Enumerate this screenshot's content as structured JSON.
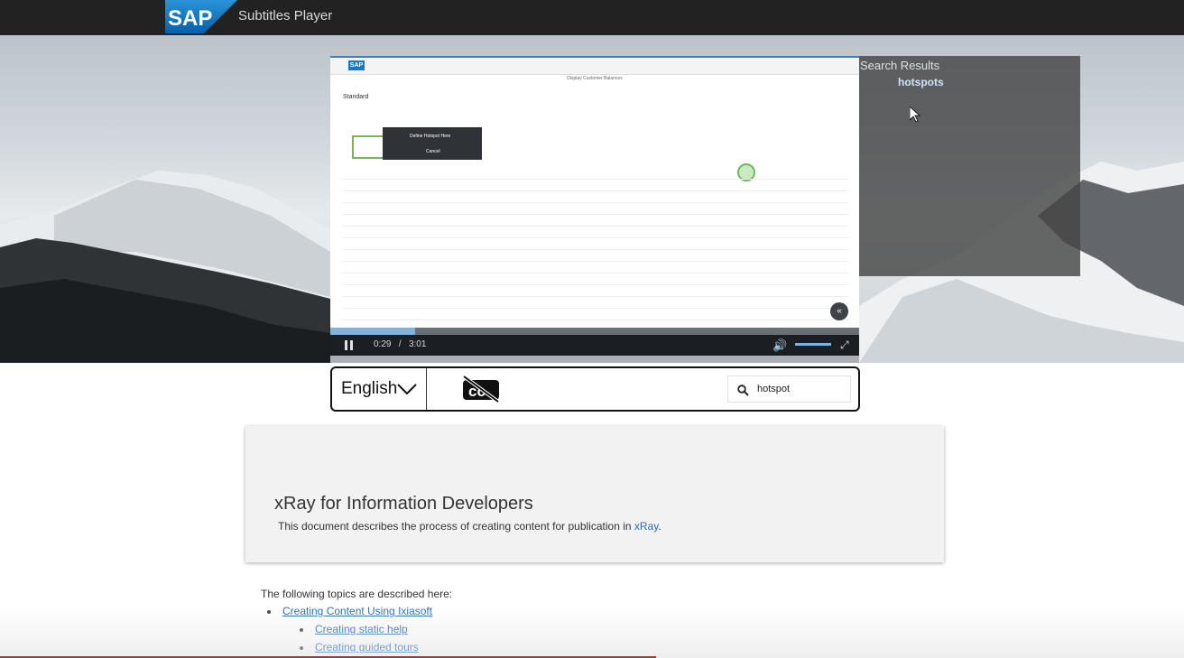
{
  "header": {
    "logo_text": "SAP",
    "app_title": "Subtitles Player"
  },
  "video": {
    "embedded_logo_text": "SAP",
    "embedded_page_title": "Display Customer Balances",
    "embedded_variant_label": "Standard",
    "embedded_popup_line1": "Define Hotspot Here",
    "embedded_popup_line2": "Cancel",
    "current_time": "0:29",
    "duration": "3:01",
    "progress_fraction": 0.16,
    "volume_fraction": 0.8
  },
  "search_results": {
    "title": "Search Results",
    "items": [
      "hotspots"
    ]
  },
  "controls": {
    "language": "English",
    "search_value": "hotspot",
    "cc_icon": "closed-captions-off-icon",
    "search_icon": "search-icon"
  },
  "document": {
    "title": "xRay for Information Developers",
    "description_prefix": "This document describes the process of creating content for publication in ",
    "description_link": "xRay",
    "description_suffix": "."
  },
  "topics": {
    "intro": "The following topics are described here:",
    "items": [
      {
        "label": "Creating Content Using Ixiasoft",
        "children": [
          "Creating static help",
          "Creating guided tours"
        ]
      }
    ]
  },
  "colors": {
    "header_bg": "#222222",
    "sap_blue": "#1a78c2",
    "link": "#2a6ebb",
    "hotspot_green": "#6cbd5a",
    "progress_red": "#e02020"
  }
}
